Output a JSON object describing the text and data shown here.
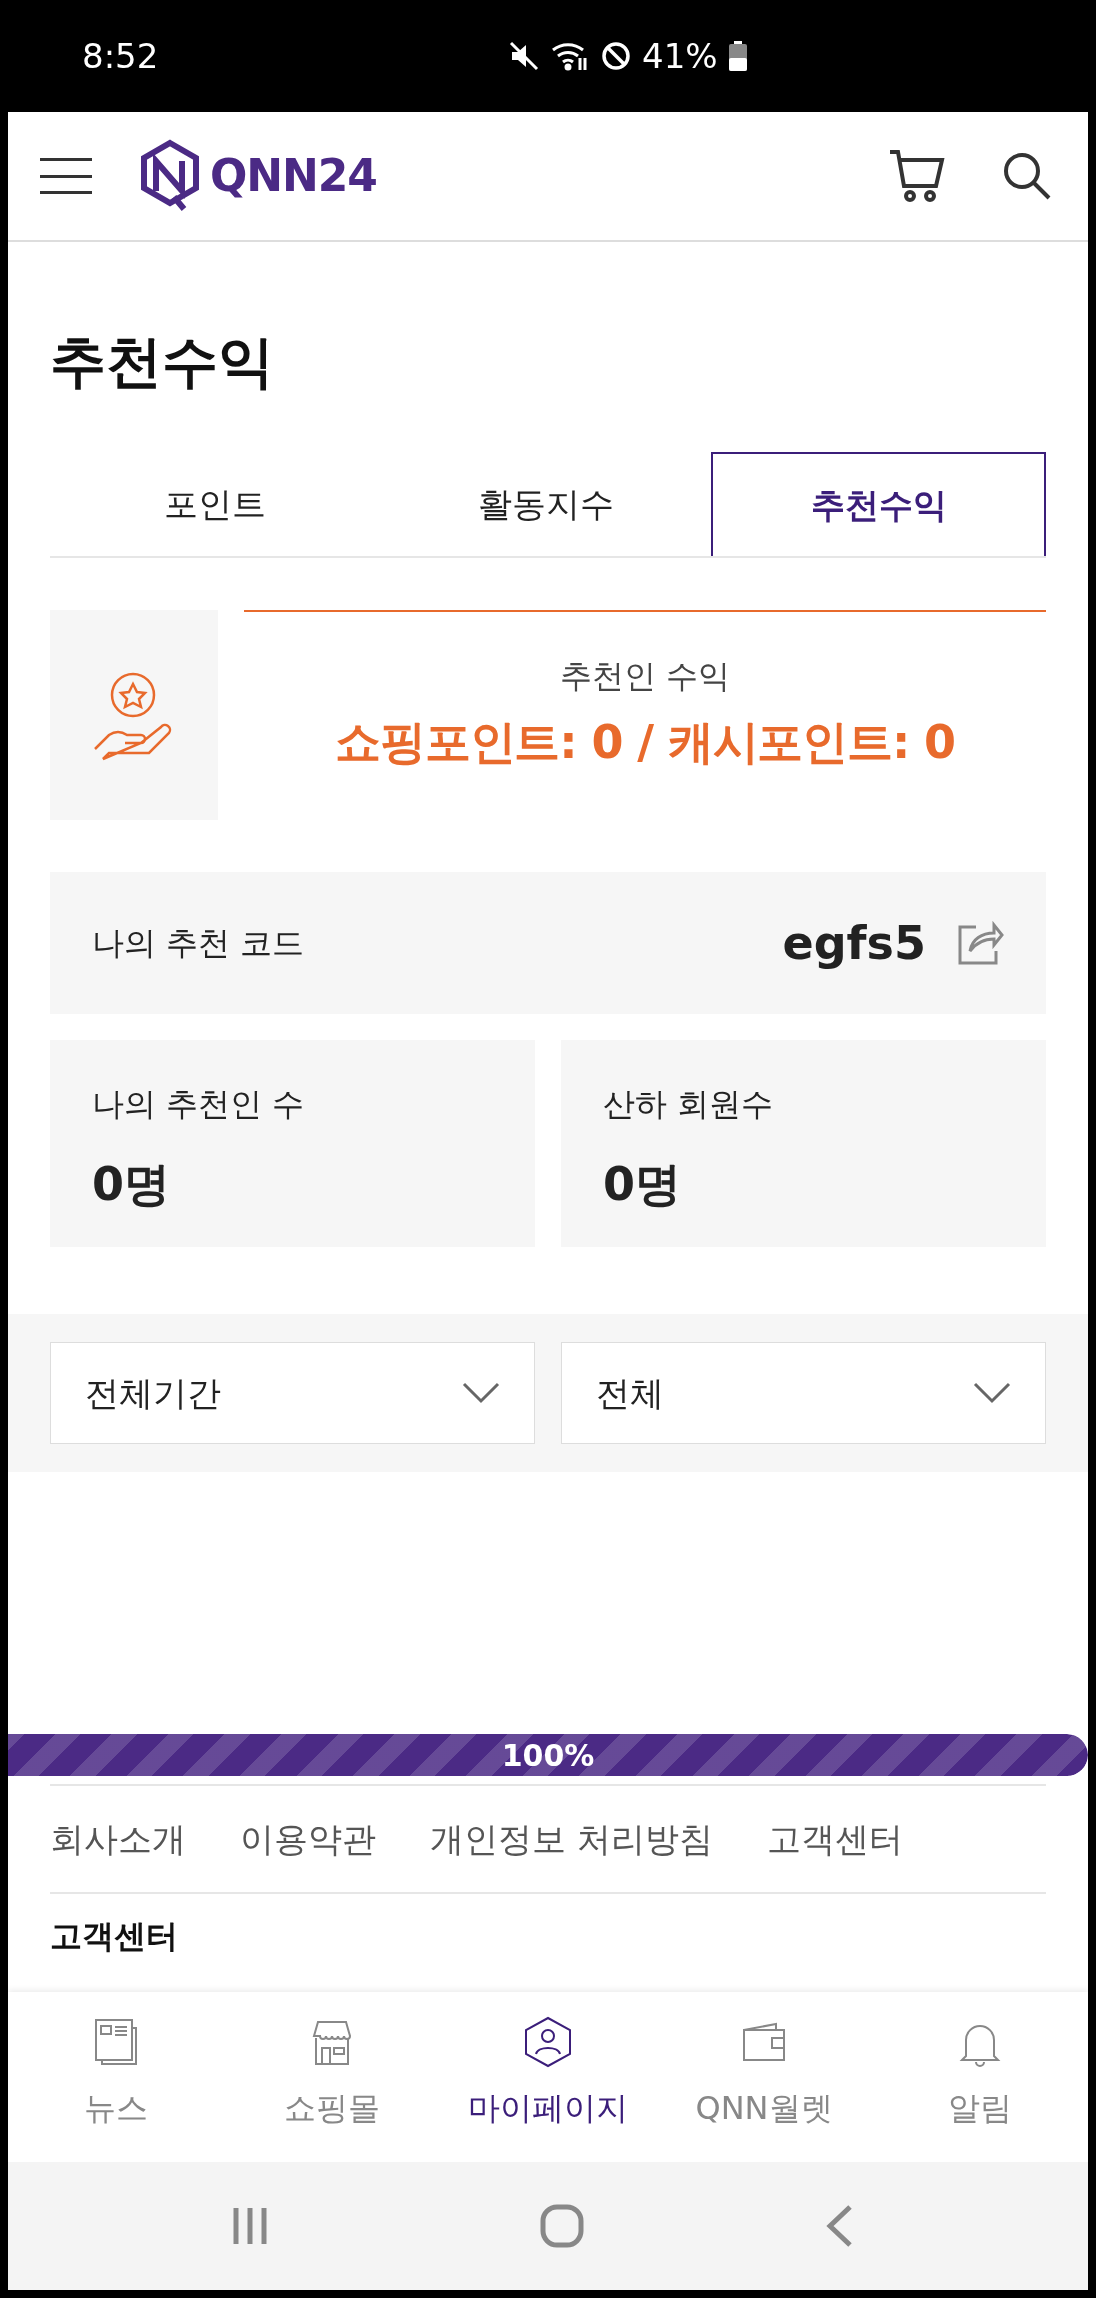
{
  "status_bar": {
    "time": "8:52",
    "battery": "41%"
  },
  "header": {
    "logo": "QNN24"
  },
  "page_title": "추천수익",
  "tabs": [
    {
      "label": "포인트",
      "selected": false
    },
    {
      "label": "활동지수",
      "selected": false
    },
    {
      "label": "추천수익",
      "selected": true
    }
  ],
  "earnings": {
    "title": "추천인 수익",
    "summary": "쇼핑포인트: 0 / 캐시포인트: 0"
  },
  "referral_code": {
    "label": "나의 추천 코드",
    "value": "egfs5"
  },
  "stats": [
    {
      "label": "나의 추천인 수",
      "value": "0명"
    },
    {
      "label": "산하 회원수",
      "value": "0명"
    }
  ],
  "filters": [
    {
      "value": "전체기간"
    },
    {
      "value": "전체"
    }
  ],
  "progress": {
    "level": 1,
    "reading": "100%"
  },
  "footer_links": [
    "회사소개",
    "이용약관",
    "개인정보 처리방침",
    "고객센터"
  ],
  "footer_heading": "고객센터",
  "bottom_nav": [
    {
      "label": "뉴스",
      "kind": "news",
      "selected": false
    },
    {
      "label": "쇼핑몰",
      "kind": "shop",
      "selected": false
    },
    {
      "label": "마이페이지",
      "kind": "mypage",
      "selected": true
    },
    {
      "label": "QNN월렛",
      "kind": "wallet",
      "selected": false
    },
    {
      "label": "알림",
      "kind": "bell",
      "selected": false
    }
  ]
}
